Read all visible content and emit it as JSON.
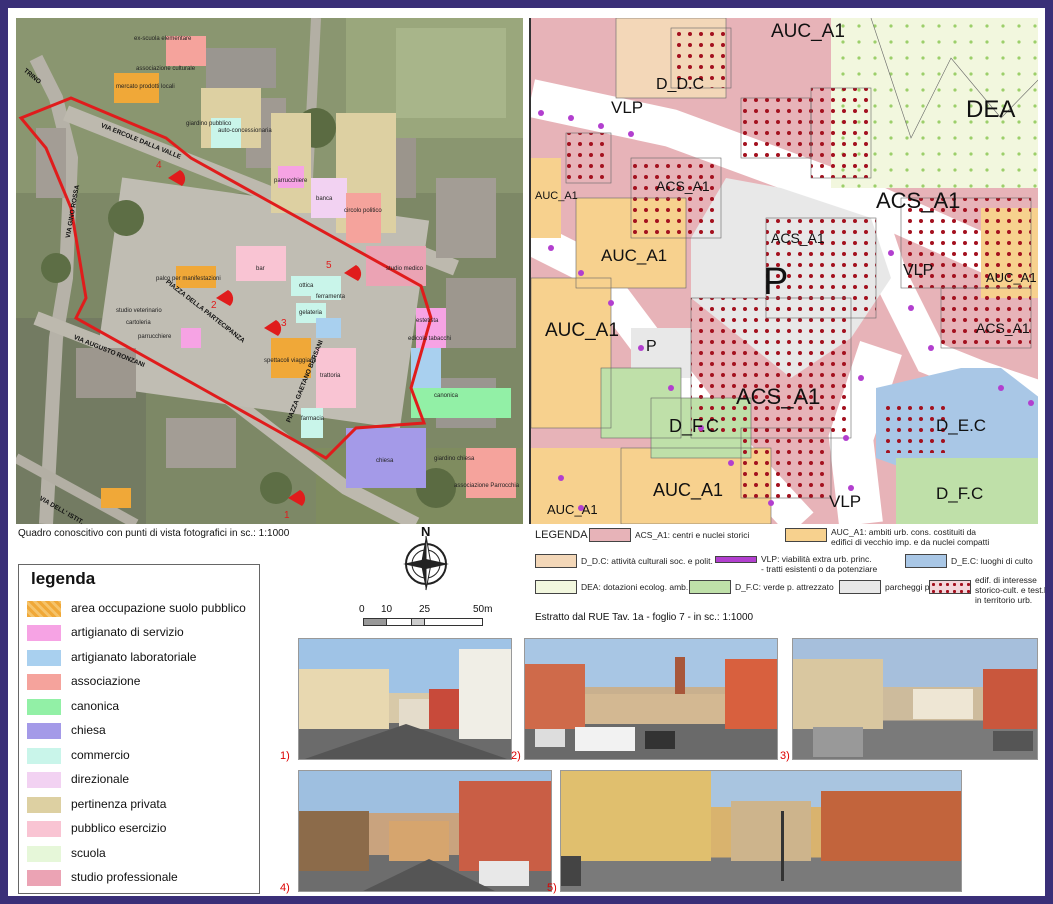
{
  "aerial": {
    "caption": "Quadro conoscitivo con punti di vista fotografici in sc.: 1:1000",
    "roads": [
      "TRINO",
      "VIA ERCOLE DALLA VALLE",
      "VIA GINO ROSSA",
      "VIA AUGUSTO RONZANI",
      "PIAZZA DELLA PARTECIPANZA",
      "PIAZZA GAETANO BERSANI",
      "VIA DELL' ISTIT..."
    ],
    "places": [
      "ex-scuola elementare",
      "associazione culturale",
      "mercato prodotti locali",
      "giardino pubblico",
      "auto-concessionaria",
      "parrucchiere",
      "banca",
      "circolo politico",
      "bar",
      "palco per manifestazioni",
      "studio veterinario",
      "cartoleria",
      "parrucchiere",
      "ottica",
      "ferramenta",
      "gelateria",
      "spettacoli viaggianti",
      "trattoria",
      "farmacia",
      "studio medico",
      "estetista",
      "edicola tabacchi",
      "canonica",
      "chiesa",
      "giardino chiesa",
      "associazione Parrocchia"
    ],
    "viewpoints": [
      "1",
      "2",
      "3",
      "4",
      "5"
    ]
  },
  "rue": {
    "zones": [
      "AUC_A1",
      "D_D.C",
      "VLP",
      "DEA",
      "ACS_A1",
      "ACS_A1",
      "AUC_A1",
      "AUC_A1",
      "ACS_A1",
      "P",
      "VLP",
      "AUC_A1",
      "AUC_A1",
      "ACS_A1",
      "P",
      "ACS_A1",
      "D_F.C",
      "D_E.C",
      "AUC_A1",
      "VLP",
      "D_F.C",
      "AUC_A1"
    ],
    "legend_title": "LEGENDA",
    "legend": [
      {
        "text": "ACS_A1: centri e nuclei storici",
        "color": "#e7b3b8"
      },
      {
        "text": "AUC_A1: ambiti urb. cons. costituiti da\nedifici di vecchio imp. e da nuclei compatti",
        "color": "#f7d18e"
      },
      {
        "text": "D_D.C: attività culturali soc. e polit.",
        "color": "#f3d7b8"
      },
      {
        "text": "VLP: viabilità extra urb. princ.\n- tratti esistenti o da potenziare",
        "color": "#b23fcf"
      },
      {
        "text": "D_E.C: luoghi di culto",
        "color": "#a9c7e6"
      },
      {
        "text": "DEA: dotazioni ecolog. amb.",
        "color": "#f2f7de"
      },
      {
        "text": "D_F.C: verde p. attrezzato",
        "color": "#bfe0a9"
      },
      {
        "text": "parcheggi p.",
        "color": "#e8e8e8"
      },
      {
        "text": "edif. di interesse\nstorico-cult. e test.le\nin territorio urb.",
        "color": "#f2d6da"
      }
    ],
    "caption": "Estratto dal RUE Tav. 1a - foglio 7 - in sc.: 1:1000"
  },
  "compass": {
    "north": "N"
  },
  "scale": {
    "ticks": [
      "0",
      "10",
      "25",
      "50m"
    ]
  },
  "legenda": {
    "title": "legenda",
    "items": [
      {
        "text": "area occupazione suolo pubblico",
        "color": "#f0a838"
      },
      {
        "text": "artigianato di servizio",
        "color": "#f6a3e4"
      },
      {
        "text": "artigianato laboratoriale",
        "color": "#a9d0ef"
      },
      {
        "text": "associazione",
        "color": "#f5a39c"
      },
      {
        "text": "canonica",
        "color": "#92f0a6"
      },
      {
        "text": "chiesa",
        "color": "#a49ae8"
      },
      {
        "text": "commercio",
        "color": "#c9f5ea"
      },
      {
        "text": "direzionale",
        "color": "#f2d2f2"
      },
      {
        "text": "pertinenza privata",
        "color": "#ddd0a2"
      },
      {
        "text": "pubblico esercizio",
        "color": "#f9c4d3"
      },
      {
        "text": "scuola",
        "color": "#e6f7d9"
      },
      {
        "text": "studio professionale",
        "color": "#eba3b4"
      }
    ]
  },
  "photos": [
    "1)",
    "2)",
    "3)",
    "4)",
    "5)"
  ]
}
